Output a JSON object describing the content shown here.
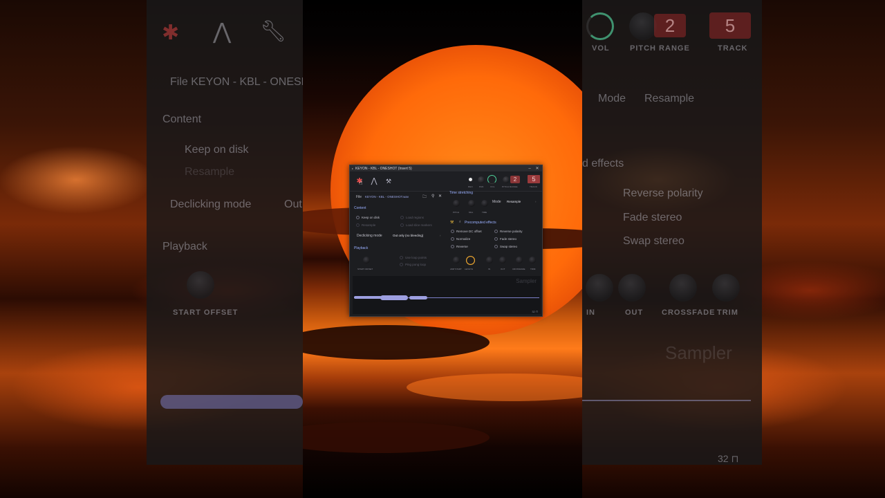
{
  "window": {
    "title": "KEYON - KBL - ONESHOT (Insert 5)",
    "minimize": "‒",
    "close": "✕"
  },
  "toolbar": {
    "icons": [
      "sampler-tab-icon",
      "envelope-tab-icon",
      "tools-tab-icon"
    ],
    "knobs": [
      "DEC",
      "PAN",
      "VOL",
      "PITCH RANGE",
      "TRACK"
    ],
    "pitch_range_value": "2",
    "track_value": "5"
  },
  "file": {
    "label": "File",
    "name": "KEYON - KBL - ONESHOT.wav"
  },
  "content": {
    "title": "Content",
    "keep_on_disk": "Keep on disk",
    "resample": "Resample",
    "load_regions": "Load regions",
    "load_slice_markers": "Load slice markers",
    "declicking_label": "Declicking mode",
    "declicking_value": "Out only (no bleeding)"
  },
  "playback": {
    "title": "Playback",
    "use_loop_points": "Use loop points",
    "ping_pong_loop": "Ping pong loop",
    "start_offset": "START OFFSET"
  },
  "time_stretching": {
    "title": "Time stretching",
    "knobs": [
      "PITCH",
      "MUL",
      "TIME"
    ],
    "mode_label": "Mode",
    "mode_value": "Resample"
  },
  "precomputed": {
    "title": "Precomputed effects",
    "left": [
      "Remove DC offset",
      "Normalize",
      "Reverse"
    ],
    "right": [
      "Reverse polarity",
      "Fade stereo",
      "Swap stereo"
    ],
    "knobs": [
      "AMP START",
      "LENGTH",
      "IN",
      "OUT",
      "CROSSFADE",
      "TRIM"
    ]
  },
  "waveform": {
    "watermark": "Sampler",
    "counter": "32 ⊓"
  },
  "ghost_left": {
    "file": "File  KEYON - KBL - ONESHOT",
    "content": "Content",
    "keep": "Keep on disk",
    "resample": "Resample",
    "declick": "Declicking mode",
    "declick_val": "Out",
    "playback": "Playback",
    "start": "START OFFSET"
  },
  "ghost_right": {
    "vol": "VOL",
    "pitch": "PITCH RANGE",
    "track": "TRACK",
    "pitch_val": "2",
    "track_val": "5",
    "mode": "Mode",
    "mode_val": "Resample",
    "effects": "d effects",
    "rev_pol": "Reverse polarity",
    "fade": "Fade stereo",
    "swap": "Swap stereo",
    "in": "IN",
    "out": "OUT",
    "crossfade": "CROSSFADE",
    "trim": "TRIM",
    "sampler": "Sampler",
    "counter": "32 ⊓"
  }
}
